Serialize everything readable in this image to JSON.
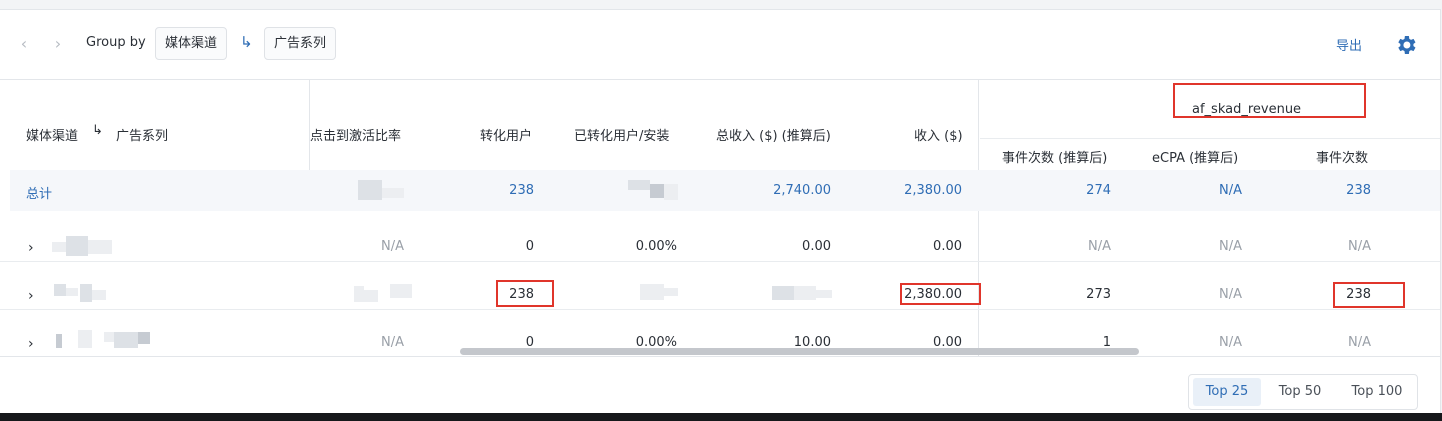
{
  "toolbar": {
    "group_by_label": "Group by",
    "group_chip_1": "媒体渠道",
    "group_chip_2": "广告系列",
    "export_label": "导出"
  },
  "table": {
    "headers": {
      "dimension_1": "媒体渠道",
      "dimension_2": "广告系列",
      "click_to_install_ratio": "点击到激活比率",
      "converted_users": "转化用户",
      "converted_per_install": "已转化用户/安装",
      "total_revenue_estimated": "总收入 ($) (推算后)",
      "revenue": "收入 ($)",
      "event_group": "af_skad_revenue",
      "event_count_estimated": "事件次数 (推算后)",
      "ecpa_estimated": "eCPA (推算后)",
      "event_count": "事件次数"
    },
    "total": {
      "label": "总计",
      "converted_users": "238",
      "total_revenue_estimated": "2,740.00",
      "revenue": "2,380.00",
      "event_count_estimated": "274",
      "ecpa_estimated": "N/A",
      "event_count": "238"
    },
    "rows": [
      {
        "click_to_install_ratio": "N/A",
        "converted_users": "0",
        "converted_per_install": "0.00%",
        "total_revenue_estimated": "0.00",
        "revenue": "0.00",
        "event_count_estimated": "N/A",
        "ecpa_estimated": "N/A",
        "event_count": "N/A"
      },
      {
        "converted_users": "238",
        "revenue": "2,380.00",
        "event_count_estimated": "273",
        "ecpa_estimated": "N/A",
        "event_count": "238"
      },
      {
        "click_to_install_ratio": "N/A",
        "converted_users": "0",
        "converted_per_install": "0.00%",
        "total_revenue_estimated": "10.00",
        "revenue": "0.00",
        "event_count_estimated": "1",
        "ecpa_estimated": "N/A",
        "event_count": "N/A"
      }
    ]
  },
  "pager": {
    "options": [
      "Top 25",
      "Top 50",
      "Top 100"
    ],
    "selected": "Top 25"
  },
  "colors": {
    "accent": "#2f6db5",
    "highlight_box": "#e0352b"
  }
}
